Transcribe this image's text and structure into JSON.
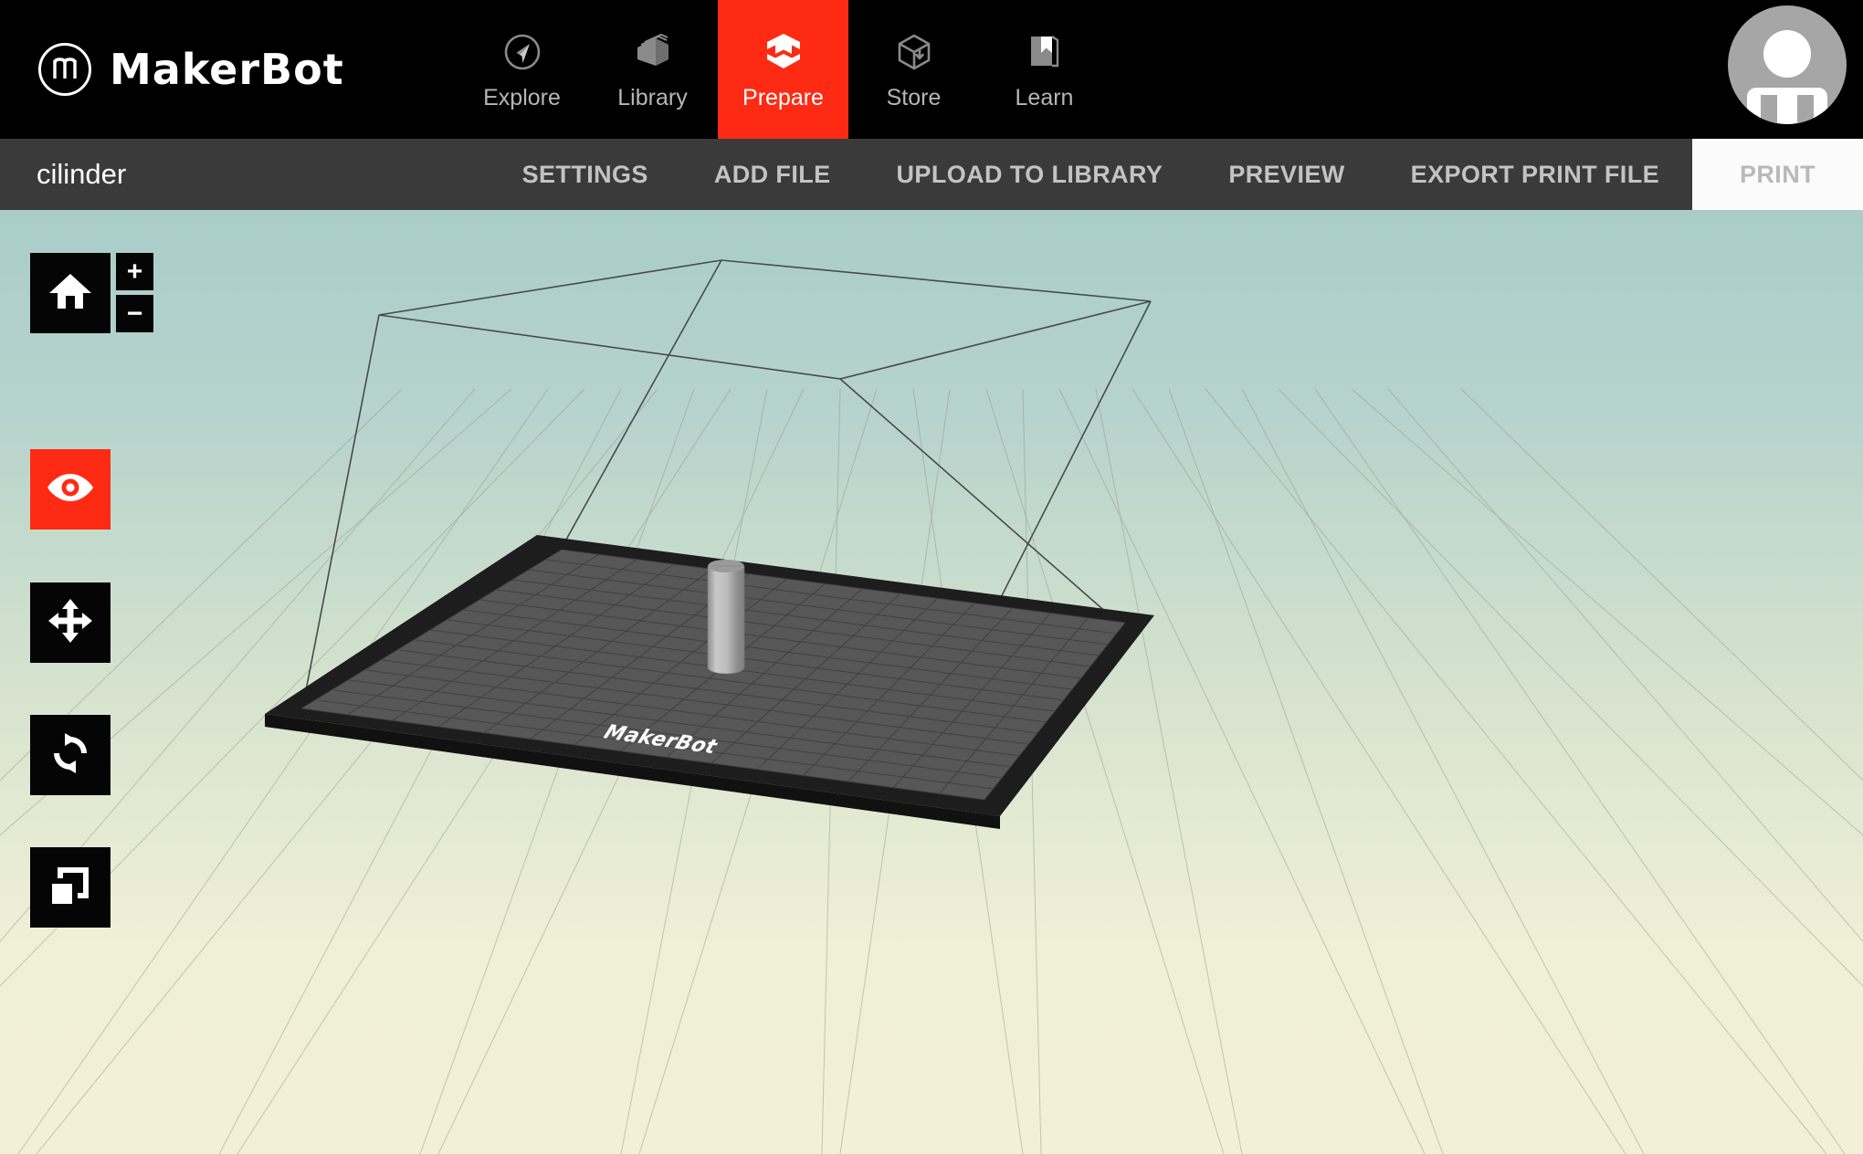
{
  "app": {
    "brand_name": "MakerBot",
    "brand_icon": "makerbot-logo-icon",
    "accent_color": "#ff2a13",
    "nav_bar_color": "#000000",
    "subbar_color": "#3a3a3a"
  },
  "topnav": {
    "items": [
      {
        "label": "Explore",
        "icon": "compass-icon",
        "active": false
      },
      {
        "label": "Library",
        "icon": "books-stack-icon",
        "active": false
      },
      {
        "label": "Prepare",
        "icon": "prepare-cube-icon",
        "active": true
      },
      {
        "label": "Store",
        "icon": "box-download-icon",
        "active": false
      },
      {
        "label": "Learn",
        "icon": "book-open-icon",
        "active": false
      }
    ],
    "account": {
      "icon": "avatar-person-icon",
      "label": ""
    }
  },
  "subbar": {
    "document_name": "cilinder",
    "actions": [
      {
        "label": "SETTINGS",
        "primary": false
      },
      {
        "label": "ADD FILE",
        "primary": false
      },
      {
        "label": "UPLOAD TO LIBRARY",
        "primary": false
      },
      {
        "label": "PREVIEW",
        "primary": false
      },
      {
        "label": "EXPORT PRINT FILE",
        "primary": false
      },
      {
        "label": "PRINT",
        "primary": true
      }
    ]
  },
  "tools": {
    "home": {
      "icon": "home-icon",
      "label": "Home view",
      "active": false
    },
    "zoom_in": {
      "icon": "plus-icon",
      "label": "+"
    },
    "zoom_out": {
      "icon": "minus-icon",
      "label": "−"
    },
    "view": {
      "icon": "eye-icon",
      "label": "View",
      "active": true
    },
    "move": {
      "icon": "move-arrows-icon",
      "label": "Move",
      "active": false
    },
    "rotate": {
      "icon": "rotate-arrows-icon",
      "label": "Rotate",
      "active": false
    },
    "scale": {
      "icon": "scale-squares-icon",
      "label": "Scale",
      "active": false
    }
  },
  "viewport": {
    "build_plate_brand": "MakerBot",
    "model_name": "cilinder",
    "model_shape": "cylinder",
    "background_top_color": "#a9cdca",
    "background_bottom_color": "#f3f0d7",
    "plate_frame_color": "#1d1d1d",
    "plate_surface_color": "#575757",
    "build_volume_edge_color": "#4a4a4a",
    "model_color": "#b0b0b0"
  }
}
